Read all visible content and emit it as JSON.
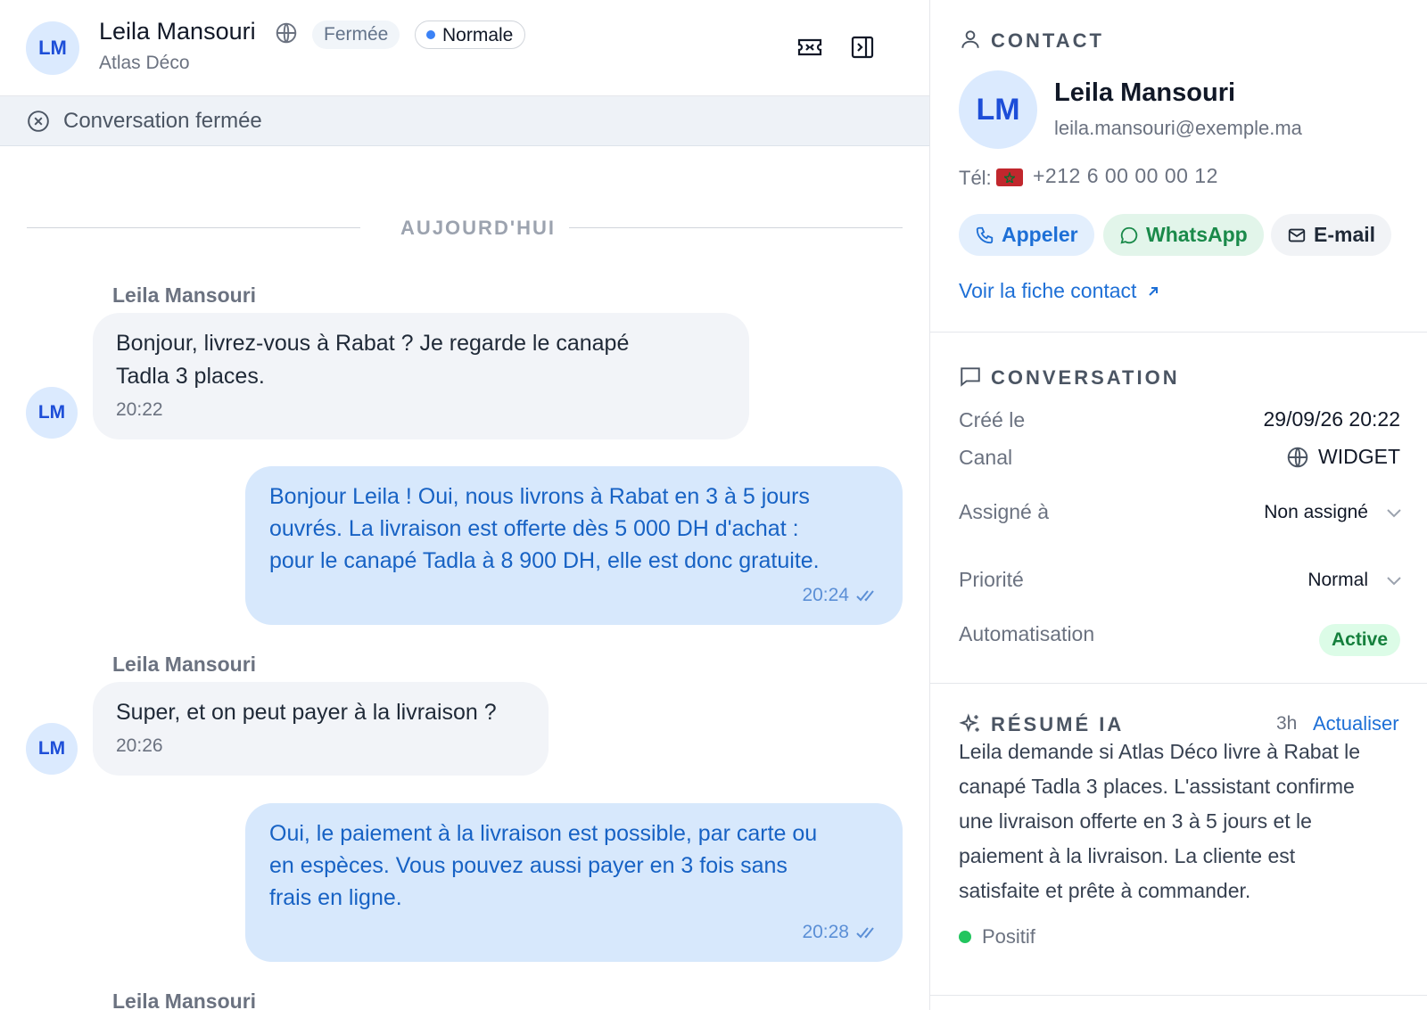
{
  "header": {
    "avatar_initials": "LM",
    "name": "Leila Mansouri",
    "company": "Atlas Déco",
    "status_badge": "Fermée",
    "priority_badge": "Normale",
    "channel_icon": "globe-icon",
    "actions": [
      "ticket-icon",
      "panel-right-icon"
    ]
  },
  "banner": {
    "icon": "x-circle-icon",
    "text": "Conversation fermée"
  },
  "day_separator": "AUJOURD'HUI",
  "messages": [
    {
      "direction": "in",
      "sender": "Leila Mansouri",
      "avatar": "LM",
      "lines": [
        "Bonjour, livrez-vous à Rabat ? Je regarde le canapé",
        "Tadla 3 places."
      ],
      "time": "20:22"
    },
    {
      "direction": "out",
      "lines": [
        "Bonjour Leila ! Oui, nous livrons à Rabat en 3 à 5 jours",
        "ouvrés. La livraison est offerte dès 5 000 DH d'achat :",
        "pour le canapé Tadla à 8 900 DH, elle est donc gratuite."
      ],
      "time": "20:24",
      "read": true
    },
    {
      "direction": "in",
      "sender": "Leila Mansouri",
      "avatar": "LM",
      "lines": [
        "Super, et on peut payer à la livraison ?"
      ],
      "time": "20:26"
    },
    {
      "direction": "out",
      "lines": [
        "Oui, le paiement à la livraison est possible, par carte ou",
        "en espèces. Vous pouvez aussi payer en 3 fois sans",
        "frais en ligne."
      ],
      "time": "20:28",
      "read": true
    },
    {
      "direction": "in",
      "sender": "Leila Mansouri"
    }
  ],
  "contact": {
    "section_title": "CONTACT",
    "avatar_initials": "LM",
    "name": "Leila Mansouri",
    "email": "leila.mansouri@exemple.ma",
    "tel_label": "Tél:",
    "phone": "+212 6 00 00 00 12",
    "flag": "morocco-flag",
    "actions": {
      "call": "Appeler",
      "whatsapp": "WhatsApp",
      "email": "E-mail"
    },
    "profile_link": "Voir la fiche contact"
  },
  "conversation": {
    "section_title": "CONVERSATION",
    "created_label": "Créé le",
    "created_value": "29/09/26 20:22",
    "channel_label": "Canal",
    "channel_value": "WIDGET",
    "assigned_label": "Assigné à",
    "assigned_value": "Non assigné",
    "priority_label": "Priorité",
    "priority_value": "Normal",
    "automation_label": "Automatisation",
    "automation_value": "Active"
  },
  "ai_summary": {
    "section_title": "RÉSUMÉ IA",
    "age": "3h",
    "refresh_label": "Actualiser",
    "lines": [
      "Leila demande si Atlas Déco livre à Rabat le",
      "canapé Tadla 3 places. L'assistant confirme",
      "une livraison offerte en 3 à 5 jours et le",
      "paiement à la livraison. La cliente est",
      "satisfaite et prête à commander."
    ],
    "sentiment": "Positif"
  },
  "colors": {
    "accent": "#1d6fd6",
    "outgoing_bubble": "#d7e8fc",
    "incoming_bubble": "#f2f4f8",
    "positive": "#22c55e"
  }
}
